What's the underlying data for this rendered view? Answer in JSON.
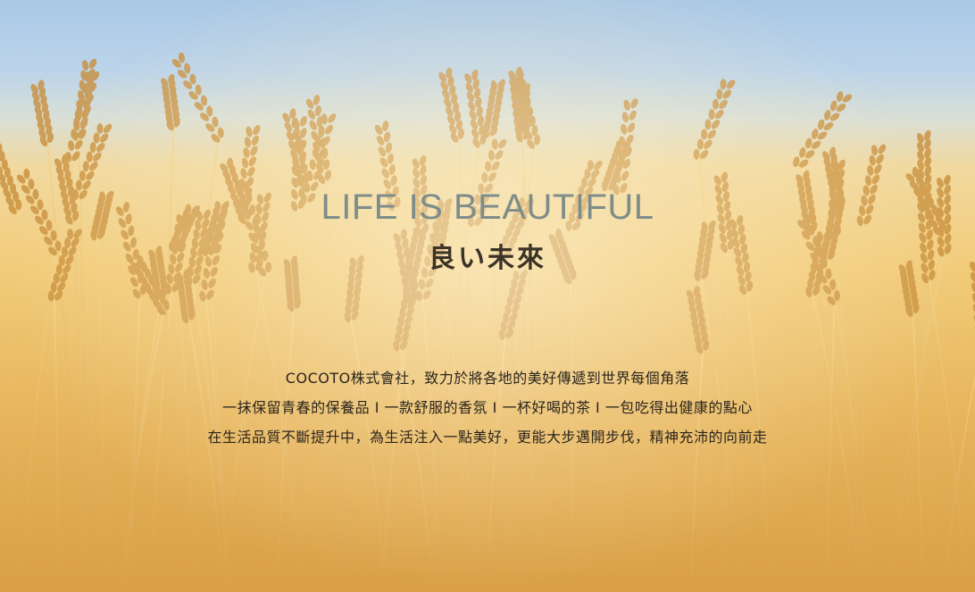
{
  "hero": {
    "title_en": "LIFE IS BEAUTIFUL",
    "title_jp": "良い未來",
    "lines": [
      "COCOTO株式會社，致力於將各地的美好傳遞到世界每個角落",
      "一抹保留青春的保養品 I 一款舒服的香氛 I 一杯好喝的茶 I 一包吃得出健康的點心",
      "在生活品質不斷提升中，為生活注入一點美好，更能大步邁開步伐，精神充沛的向前走"
    ]
  },
  "colors": {
    "title_en": "#7f8d8a",
    "title_jp": "#3b3328",
    "body_text": "#2b251d",
    "sky": "#a9c8e6",
    "wheat": "#e7b55c"
  }
}
